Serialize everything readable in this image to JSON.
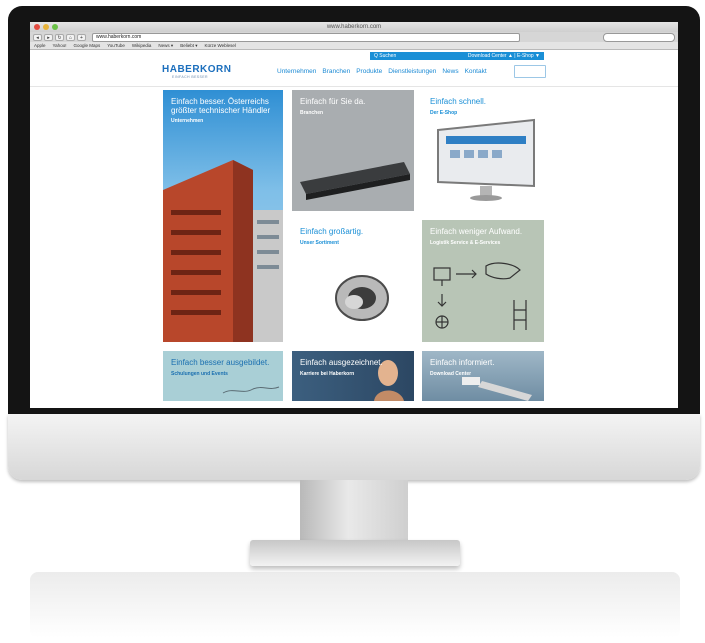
{
  "browser": {
    "window_title": "www.haberkorn.com",
    "url": "www.haberkorn.com",
    "bookmarks": [
      "Apple",
      "Yahoo!",
      "Google Maps",
      "YouTube",
      "Wikipedia",
      "News ▾",
      "Beliebt ▾",
      "Kürze Weblesel"
    ]
  },
  "site": {
    "logo": "HABERKORN",
    "logo_sub": "EINFACH BESSER",
    "topbar": {
      "search": "Q Suchen",
      "links": "Download Center ▲ | E-Shop ▼"
    },
    "nav": [
      "Unternehmen",
      "Branchen",
      "Produkte",
      "Dienstleistungen",
      "News",
      "Kontakt"
    ]
  },
  "tiles": [
    {
      "title": "Einfach besser. Österreichs größter technischer Händler",
      "sub": "Unternehmen"
    },
    {
      "title": "Einfach für Sie da.",
      "sub": "Branchen"
    },
    {
      "title": "Einfach schnell.",
      "sub": "Der E-Shop"
    },
    {
      "title": "Einfach großartig.",
      "sub": "Unser Sortiment"
    },
    {
      "title": "Einfach weniger Aufwand.",
      "sub": "Logistik Service & E-Services"
    },
    {
      "title": "Einfach besser ausgebildet.",
      "sub": "Schulungen und Events"
    },
    {
      "title": "Einfach ausgezeichnet.",
      "sub": "Karriere bei Haberkorn"
    },
    {
      "title": "Einfach informiert.",
      "sub": "Download Center"
    }
  ],
  "colors": {
    "accent": "#1a8fd6",
    "brand": "#1c6fbd"
  }
}
